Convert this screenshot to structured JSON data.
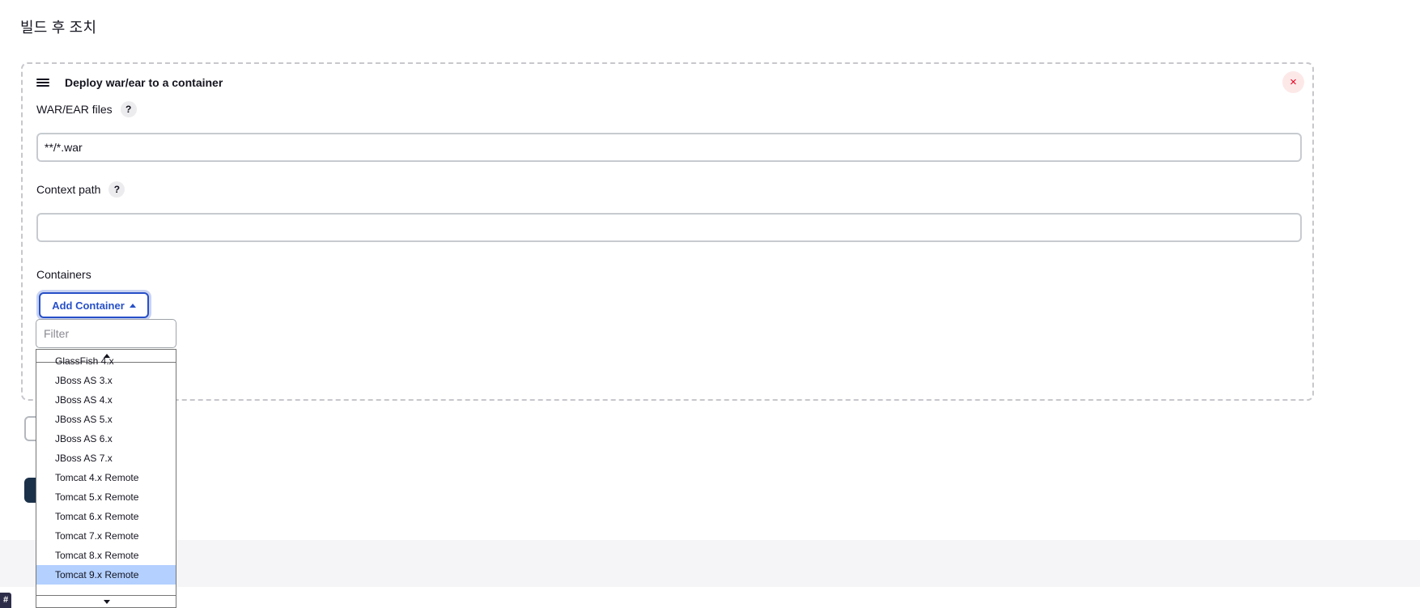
{
  "section": {
    "title": "빌드 후 조치"
  },
  "step": {
    "title": "Deploy war/ear to a container",
    "close_label": "×"
  },
  "fields": {
    "war_ear": {
      "label": "WAR/EAR files",
      "value": "**/*.war",
      "help": "?"
    },
    "context_path": {
      "label": "Context path",
      "value": "",
      "help": "?"
    }
  },
  "containers": {
    "label": "Containers",
    "add_button_label": "Add Container"
  },
  "dropdown": {
    "filter_placeholder": "Filter",
    "options": [
      "GlassFish 4.x",
      "JBoss AS 3.x",
      "JBoss AS 4.x",
      "JBoss AS 5.x",
      "JBoss AS 6.x",
      "JBoss AS 7.x",
      "Tomcat 4.x Remote",
      "Tomcat 5.x Remote",
      "Tomcat 6.x Remote",
      "Tomcat 7.x Remote",
      "Tomcat 8.x Remote",
      "Tomcat 9.x Remote"
    ],
    "selected": "Tomcat 9.x Remote"
  },
  "corner_badge": "#",
  "colors": {
    "accent": "#2750c8",
    "close": "#e6001f",
    "selection": "#b3d0ff",
    "dark_button": "#1b3149"
  }
}
